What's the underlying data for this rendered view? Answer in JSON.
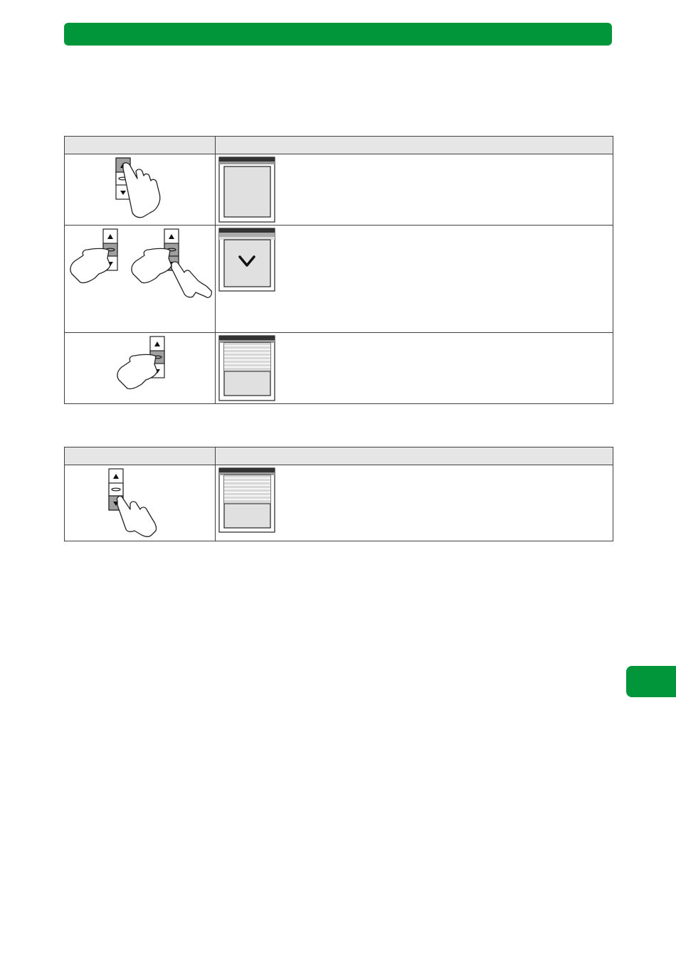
{
  "colors": {
    "accent": "#009639",
    "header_bg": "#e6e6e6",
    "border": "#404040",
    "button_pressed": "#a0a0a0"
  },
  "icons": {
    "button": "rocker-switch-icon",
    "hand": "pointing-hand-icon",
    "window": "window-shutter-icon",
    "direction": "chevron-down-icon"
  }
}
